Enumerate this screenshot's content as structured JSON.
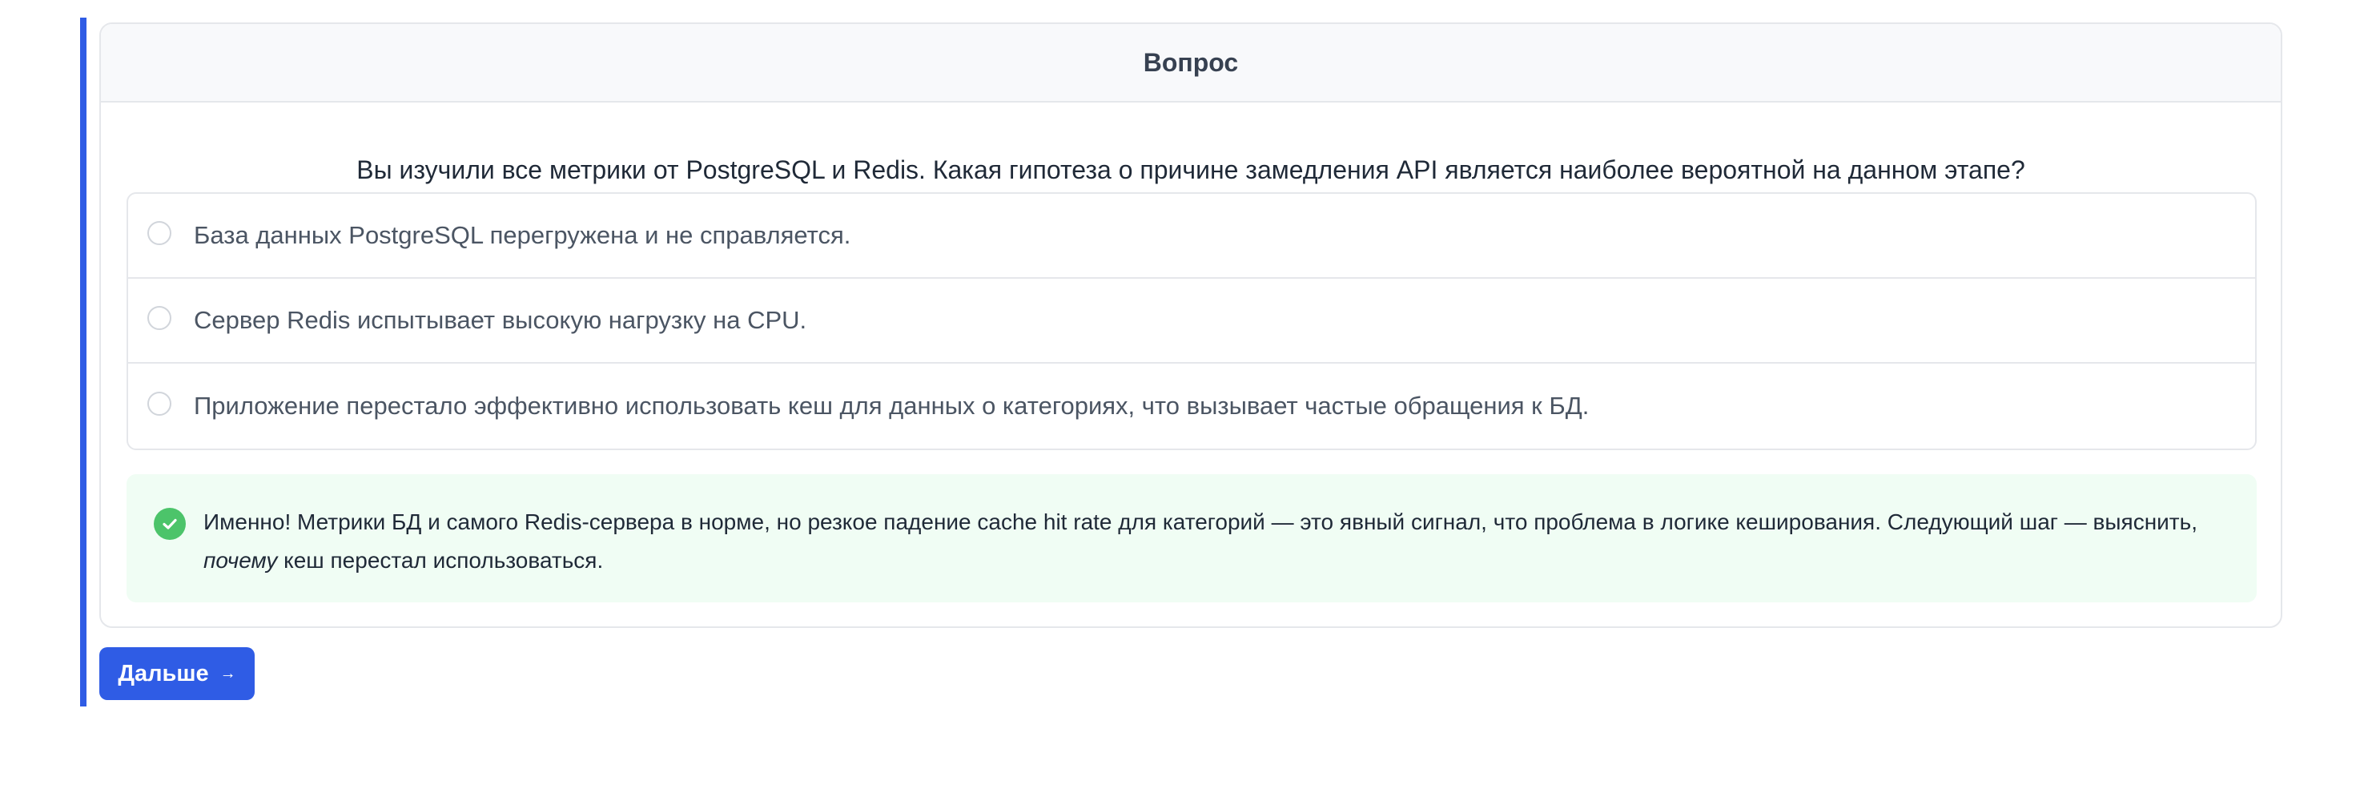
{
  "card": {
    "title": "Вопрос",
    "question": "Вы изучили все метрики от PostgreSQL и Redis. Какая гипотеза о причине замедления API является наиболее вероятной на данном этапе?"
  },
  "options": [
    {
      "label": "База данных PostgreSQL перегружена и не справляется.",
      "selected": false
    },
    {
      "label": "Сервер Redis испытывает высокую нагрузку на CPU.",
      "selected": false
    },
    {
      "label": "Приложение перестало эффективно использовать кеш для данных о категориях, что вызывает частые обращения к БД.",
      "selected": false
    }
  ],
  "feedback": {
    "icon": "check-circle-icon",
    "text_before": "Именно! Метрики БД и самого Redis-сервера в норме, но резкое падение cache hit rate для категорий — это явный сигнал, что проблема в логике кеширования. Следующий шаг — выяснить, ",
    "text_emphasis": "почему",
    "text_after": " кеш перестал использоваться."
  },
  "next_button": {
    "label": "Дальше",
    "icon": "arrow-right-icon",
    "arrow": "→"
  },
  "colors": {
    "accent": "#2f5ce5",
    "success": "#4cc46a",
    "success_bg": "#f0fdf4"
  }
}
